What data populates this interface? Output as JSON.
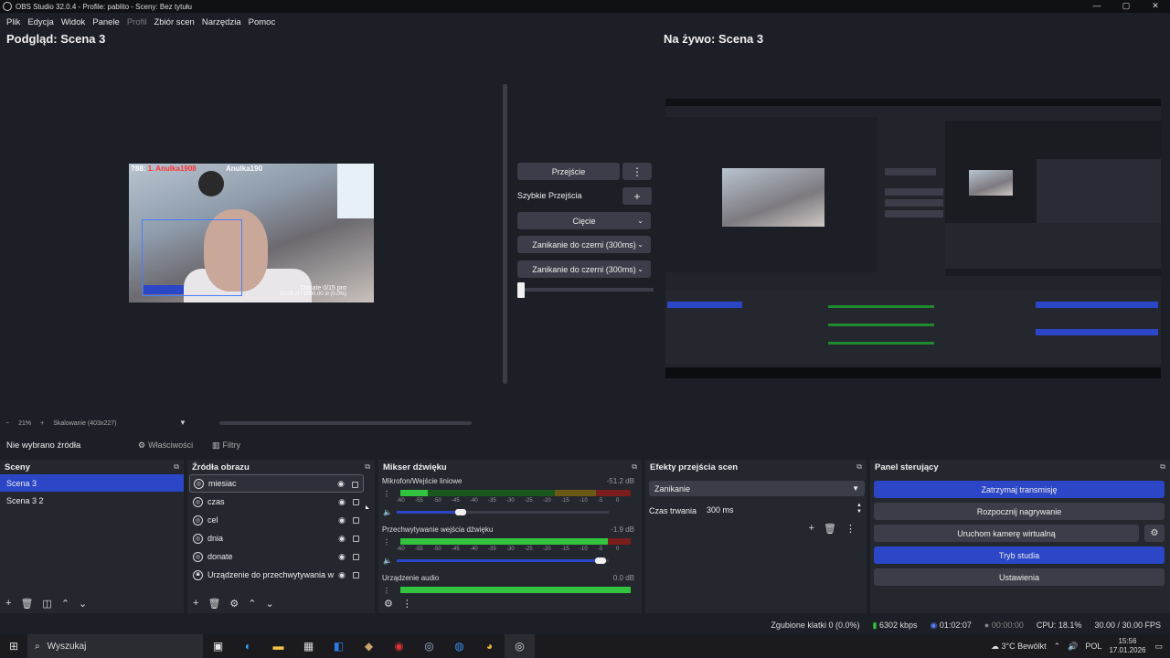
{
  "window": {
    "title": "OBS Studio 32.0.4 - Profile: pablito - Sceny: Bez tytułu",
    "controls": [
      "—",
      "▢",
      "✕"
    ]
  },
  "menu": [
    "Plik",
    "Edycja",
    "Widok",
    "Panele",
    "Profil",
    "Zbiór scen",
    "Narzędzia",
    "Pomoc"
  ],
  "preview": {
    "title": "Podgląd: Scena 3",
    "zoom": "21%",
    "scaling": "Skalowanie (403x227)",
    "overlay_top": "?88:",
    "overlay_name": "1. Anulka1908",
    "overlay_name2": "Anulka190",
    "overlay_bottom1": "Donate 0/15 pro",
    "overlay_bottom2": "10.00 zł / 1000.00 zł (0.0%)"
  },
  "program": {
    "title": "Na żywo: Scena 3"
  },
  "transitions": {
    "button": "Przejście",
    "quick_label": "Szybkie Przejścia",
    "items": [
      "Cięcie",
      "Zanikanie do czerni (300ms)",
      "Zanikanie do czerni (300ms)"
    ]
  },
  "source_bar": {
    "no_source": "Nie wybrano źródła",
    "properties": "Właściwości",
    "filters": "Filtry"
  },
  "scenes": {
    "title": "Sceny",
    "items": [
      "Scena 3",
      "Scena 3 2"
    ]
  },
  "sources": {
    "title": "Źródła obrazu",
    "items": [
      "miesiac",
      "czas",
      "cel",
      "dnia",
      "donate",
      "Urządzenie do przechwytywania w"
    ]
  },
  "mixer": {
    "title": "Mikser dźwięku",
    "channels": [
      {
        "name": "Mikrofon/Wejście liniowe",
        "db": "-51.2 dB",
        "level": 0.12,
        "volume": 0.3
      },
      {
        "name": "Przechwytywanie wejścia dźwięku",
        "db": "-1.9 dB",
        "level": 0.9,
        "volume": 0.96
      },
      {
        "name": "Urządzenie audio",
        "db": "0.0 dB",
        "level": 1.0,
        "volume": 1.0
      }
    ],
    "scale": [
      "-60",
      "-55",
      "-50",
      "-45",
      "-40",
      "-35",
      "-30",
      "-25",
      "-20",
      "-15",
      "-10",
      "-5",
      "0"
    ]
  },
  "transition_fx": {
    "title": "Efekty przejścia scen",
    "selected": "Zanikanie",
    "duration_label": "Czas trwania",
    "duration_value": "300 ms"
  },
  "controls": {
    "title": "Panel sterujący",
    "buttons": [
      "Zatrzymaj transmisję",
      "Rozpocznij nagrywanie",
      "Uruchom kamerę wirtualną",
      "Tryb studia",
      "Ustawienia"
    ]
  },
  "status": {
    "dropped": "Zgubione klatki 0 (0.0%)",
    "bitrate": "6302 kbps",
    "stream_time": "01:02:07",
    "rec_time": "00:00:00",
    "cpu": "CPU: 18.1%",
    "fps": "30.00 / 30.00 FPS"
  },
  "taskbar": {
    "search": "Wyszukaj",
    "weather": "3°C Bewölkt",
    "lang": "POL",
    "time": "15:56",
    "date": "17.01.2026"
  },
  "colors": {
    "accent": "#2b46c6",
    "bg": "#1d1f26",
    "panel": "#25272f",
    "button": "#3b3e48"
  }
}
